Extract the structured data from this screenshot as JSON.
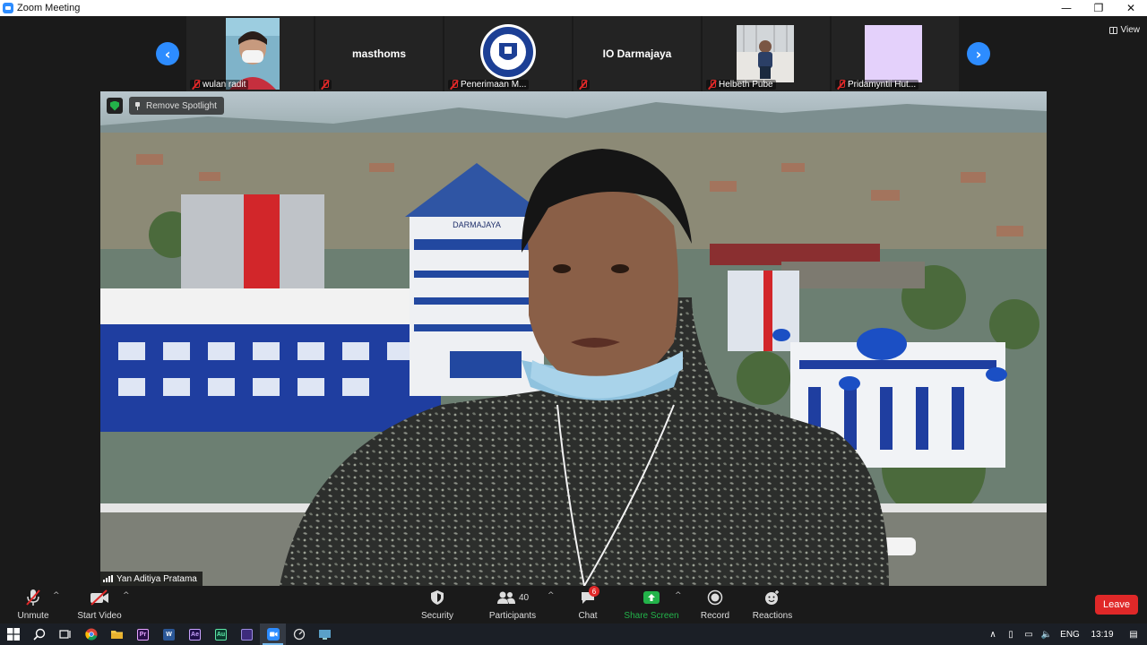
{
  "window": {
    "title": "Zoom Meeting",
    "minimize": "—",
    "restore": "❐",
    "close": "✕"
  },
  "strip": {
    "prev_icon": "chevron-left-icon",
    "next_icon": "chevron-right-icon",
    "view_label": "View",
    "participants": [
      {
        "label": "wulan radit",
        "has_video": true,
        "muted": true
      },
      {
        "label": "",
        "center_name": "masthoms",
        "muted": true
      },
      {
        "label": "Penerimaan M...",
        "has_logo": true,
        "muted": true
      },
      {
        "label": "",
        "center_name": "IO Darmajaya",
        "muted": true
      },
      {
        "label": "Helbeth Pube",
        "has_video": true,
        "muted": true
      },
      {
        "label": "Pridamyntii Hut...",
        "has_video": true,
        "muted": true
      }
    ]
  },
  "video": {
    "spotlight_label": "Remove Spotlight",
    "speaker_name": "Yan Aditiya Pratama",
    "building_sign": "DARMAJAYA"
  },
  "toolbar": {
    "unmute": "Unmute",
    "start_video": "Start Video",
    "security": "Security",
    "participants": "Participants",
    "participants_count": "40",
    "chat": "Chat",
    "chat_badge": "6",
    "share_screen": "Share Screen",
    "record": "Record",
    "reactions": "Reactions",
    "leave": "Leave",
    "caret": "^"
  },
  "taskbar": {
    "language": "ENG",
    "time": "13:19",
    "apps": [
      {
        "name": "start",
        "icon": "windows-icon"
      },
      {
        "name": "search",
        "icon": "search-icon"
      },
      {
        "name": "task-view",
        "icon": "task-view-icon"
      },
      {
        "name": "chrome",
        "icon": "chrome-icon",
        "color": "#fbbc05"
      },
      {
        "name": "explorer",
        "icon": "folder-icon",
        "color": "#f3c446"
      },
      {
        "name": "premiere",
        "icon": "premiere-icon",
        "label": "Pr",
        "color": "#2a0f4a"
      },
      {
        "name": "word",
        "icon": "word-icon",
        "label": "W",
        "color": "#2b5797"
      },
      {
        "name": "after-effects",
        "icon": "after-effects-icon",
        "label": "Ae",
        "color": "#1f0f4a"
      },
      {
        "name": "audition",
        "icon": "audition-icon",
        "label": "Au",
        "color": "#0b3b2e"
      },
      {
        "name": "app-purple",
        "icon": "purple-app-icon",
        "label": "",
        "color": "#3e2b7d"
      },
      {
        "name": "zoom",
        "icon": "zoom-icon",
        "color": "#2d8cff"
      },
      {
        "name": "app-circle",
        "icon": "circle-app-icon"
      },
      {
        "name": "app-screen",
        "icon": "screen-app-icon",
        "color": "#5aa0c8"
      }
    ]
  },
  "colors": {
    "accent": "#2d8cff",
    "danger": "#e02828",
    "share": "#23b34a"
  }
}
